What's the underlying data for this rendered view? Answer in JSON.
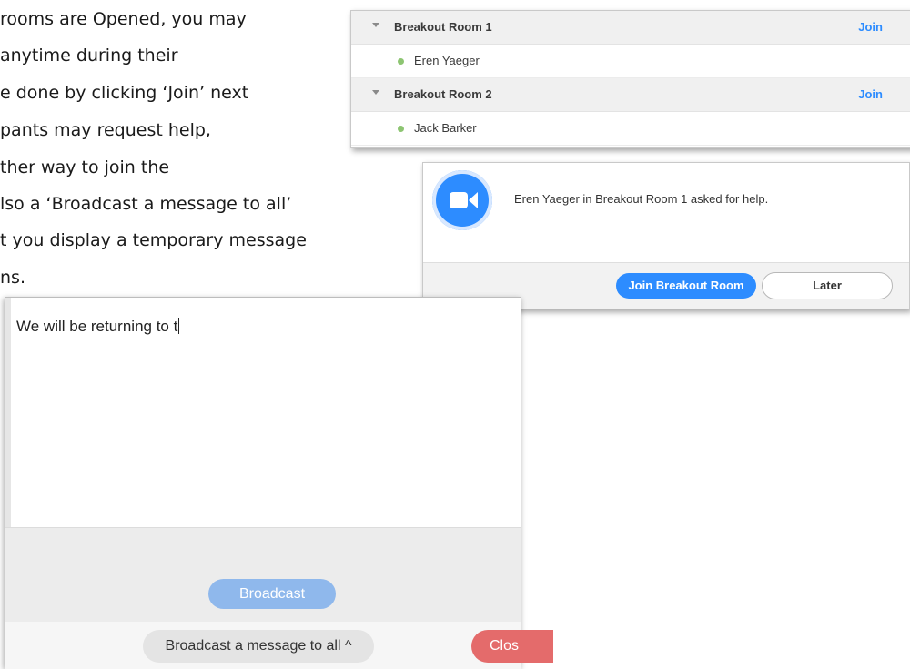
{
  "document": {
    "lines": [
      "rooms are Opened, you may",
      "anytime during their",
      "e done by clicking ‘Join’ next",
      "pants may request help,",
      "ther way to join the",
      "lso a ‘Broadcast a message to all’",
      "t you display a temporary message",
      "ns."
    ]
  },
  "rooms_panel": {
    "rooms": [
      {
        "name": "Breakout Room 1",
        "join_label": "Join",
        "member": "Eren Yaeger"
      },
      {
        "name": "Breakout Room 2",
        "join_label": "Join",
        "member": "Jack Barker"
      }
    ],
    "accent": "#2d8cff",
    "presence_color": "#8dc572"
  },
  "help_panel": {
    "message": "Eren Yaeger in Breakout Room 1 asked for help.",
    "primary_button": "Join Breakout Room",
    "secondary_button": "Later",
    "icon": "zoom-camera-icon"
  },
  "broadcast_panel": {
    "input_value": "We will be returning to t",
    "broadcast_button": "Broadcast",
    "menu_button": "Broadcast a message to all",
    "menu_chevron": "^",
    "close_button": "Clos"
  }
}
